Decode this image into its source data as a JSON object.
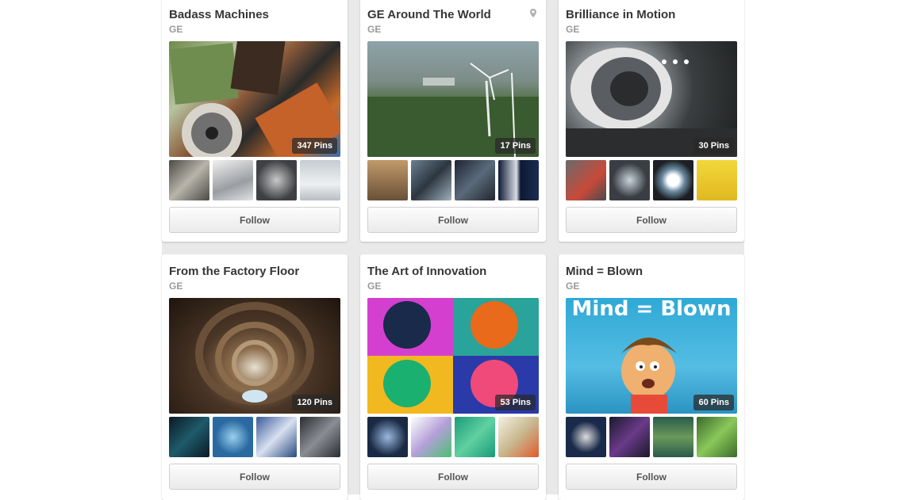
{
  "boards": [
    {
      "title": "Badass Machines",
      "owner": "GE",
      "pin_count": "347 Pins",
      "follow_label": "Follow",
      "thumbs": [
        "#8c8c84",
        "#cfd2d4",
        "#6b6e72",
        "#d8dde0"
      ]
    },
    {
      "title": "GE Around The World",
      "owner": "GE",
      "pin_count": "17 Pins",
      "follow_label": "Follow",
      "thumbs": [
        "#9b7a55",
        "#5d6e7a",
        "#3a4450",
        "#1e2a44"
      ]
    },
    {
      "title": "Brilliance in Motion",
      "owner": "GE",
      "pin_count": "30 Pins",
      "follow_label": "Follow",
      "thumbs": [
        "#8a5a50",
        "#3c4046",
        "#6a7a86",
        "#e8c82a"
      ]
    },
    {
      "title": "From the Factory Floor",
      "owner": "GE",
      "pin_count": "120 Pins",
      "follow_label": "Follow",
      "thumbs": [
        "#1f4a5a",
        "#3d7fb0",
        "#4a6fa0",
        "#555a60"
      ]
    },
    {
      "title": "The Art of Innovation",
      "owner": "GE",
      "pin_count": "53 Pins",
      "follow_label": "Follow",
      "thumbs": [
        "#1b2a44",
        "#b4a0d8",
        "#2aa37a",
        "#d8c89a"
      ]
    },
    {
      "title": "Mind = Blown",
      "owner": "GE",
      "pin_count": "60 Pins",
      "follow_label": "Follow",
      "cover_text": "Mind = Blown",
      "thumbs": [
        "#1a2a4a",
        "#3a2a4a",
        "#2a6a4a",
        "#6aa84a"
      ]
    }
  ]
}
